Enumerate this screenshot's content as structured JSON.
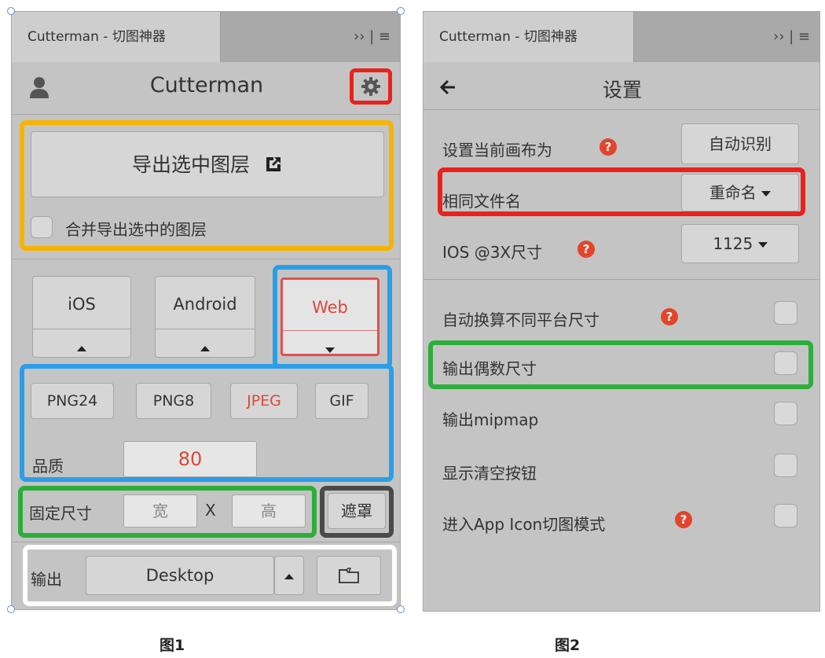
{
  "colors": {
    "panel_bg": "#c4c4c4",
    "red": "#e8221d",
    "orange": "#f6b400",
    "blue": "#2b9ee8",
    "green": "#2dae3a",
    "dark": "#4a4a4a",
    "white": "#ffffff",
    "web_red": "#d84a3b"
  },
  "panel1": {
    "tab_title": "Cutterman - 切图神器",
    "tab_menu": "›› | ≡",
    "header_title": "Cutterman",
    "user_icon": "user-icon",
    "settings_icon": "gear-icon",
    "export_button": "导出选中图层",
    "export_icon": "external-link-icon",
    "merge_label": "合并导出选中的图层",
    "platforms": [
      {
        "label": "iOS",
        "arrow": "up"
      },
      {
        "label": "Android",
        "arrow": "up"
      },
      {
        "label": "Web",
        "arrow": "down"
      }
    ],
    "formats": [
      "PNG24",
      "PNG8",
      "JPEG",
      "GIF"
    ],
    "quality_label": "品质",
    "quality_value": "80",
    "fixed_size_label": "固定尺寸",
    "width_placeholder": "宽",
    "x_label": "X",
    "height_placeholder": "高",
    "mask_button": "遮罩",
    "output_label": "输出",
    "output_value": "Desktop",
    "folder_icon": "folder-icon",
    "caption": "图1"
  },
  "panel2": {
    "tab_title": "Cutterman - 切图神器",
    "tab_menu": "›› | ≡",
    "back_icon": "arrow-left-icon",
    "header_title": "设置",
    "canvas_label": "设置当前画布为",
    "canvas_button": "自动识别",
    "same_name_label": "相同文件名",
    "same_name_value": "重命名",
    "ios3x_label": "IOS @3X尺寸",
    "ios3x_value": "1125",
    "help_symbol": "?",
    "options": [
      {
        "label": "自动换算不同平台尺寸",
        "help": true
      },
      {
        "label": "输出偶数尺寸",
        "help": false
      },
      {
        "label": "输出mipmap",
        "help": false
      },
      {
        "label": "显示清空按钮",
        "help": false
      },
      {
        "label": "进入App Icon切图模式",
        "help": true
      }
    ],
    "caption": "图2"
  }
}
